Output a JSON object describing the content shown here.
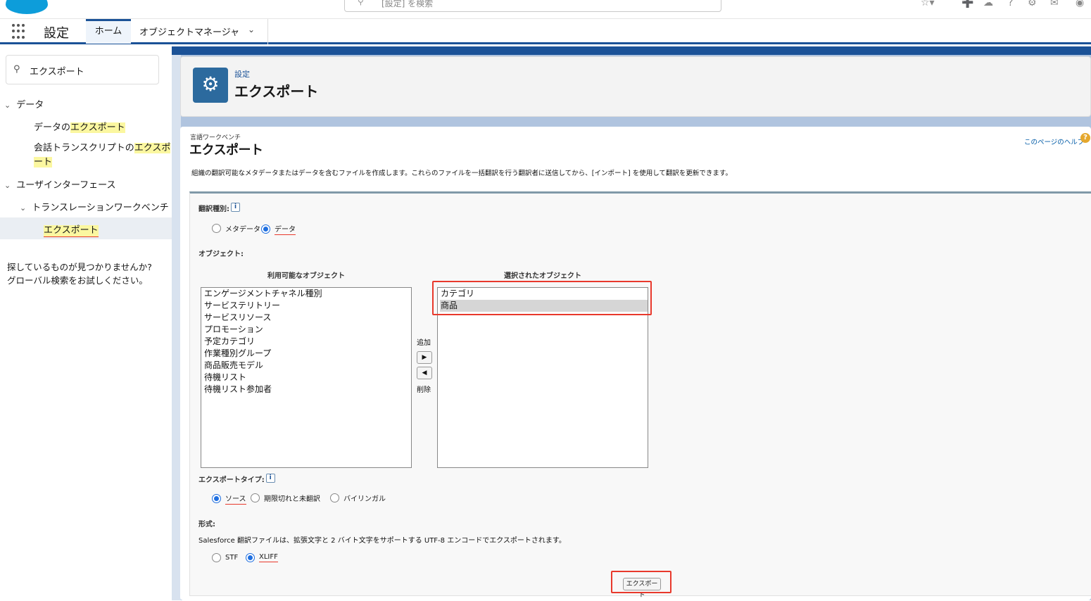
{
  "topbar": {
    "search_placeholder": "[設定] を検索"
  },
  "nav": {
    "app_name": "設定",
    "tabs": [
      {
        "label": "ホーム"
      },
      {
        "label": "オブジェクトマネージャ"
      }
    ]
  },
  "sidebar": {
    "quick_find_value": "エクスポート",
    "sections": [
      {
        "label": "データ"
      },
      {
        "label": "ユーザインターフェース"
      }
    ],
    "items": {
      "data_export_prefix": "データの",
      "data_export_hl": "エクスポート",
      "conv_prefix": "会話トランスクリプトの",
      "conv_hl1": "エクスポ",
      "conv_hl2": "ート",
      "tw_label": "トランスレーションワークベンチ",
      "tw_export": "エクスポート"
    },
    "not_found_line1": "探しているものが見つかりませんか?",
    "not_found_line2": "グローバル検索をお試しください。"
  },
  "header": {
    "subtitle": "設定",
    "title": "エクスポート"
  },
  "content": {
    "subtitle": "言語ワークベンチ",
    "title": "エクスポート",
    "help_link": "このページのヘルプ",
    "description": "組織の翻訳可能なメタデータまたはデータを含むファイルを作成します。これらのファイルを一括翻訳を行う翻訳者に送信してから、[インポート] を使用して翻訳を更新できます。",
    "translation_type_label": "翻訳種別:",
    "translation_types": [
      "メタデータ",
      "データ"
    ],
    "objects_label": "オブジェクト:",
    "available_label": "利用可能なオブジェクト",
    "selected_label": "選択されたオブジェクト",
    "available_objects": [
      "エンゲージメントチャネル種別",
      "サービステリトリー",
      "サービスリソース",
      "プロモーション",
      "予定カテゴリ",
      "作業種別グループ",
      "商品販売モデル",
      "待機リスト",
      "待機リスト参加者"
    ],
    "selected_objects": [
      "カテゴリ",
      "商品"
    ],
    "add_label": "追加",
    "remove_label": "削除",
    "export_type_label": "エクスポートタイプ:",
    "export_types": [
      "ソース",
      "期限切れと未翻訳",
      "バイリンガル"
    ],
    "format_label": "形式:",
    "format_note": "Salesforce 翻訳ファイルは、拡張文字と 2 バイト文字をサポートする UTF-8 エンコードでエクスポートされます。",
    "formats": [
      "STF",
      "XLIFF"
    ],
    "export_button": "エクスポート"
  }
}
